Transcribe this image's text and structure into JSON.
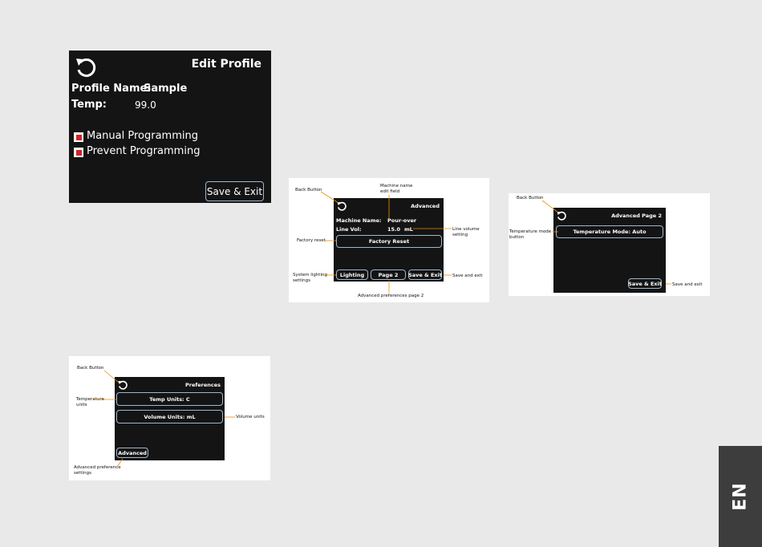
{
  "edit_profile": {
    "title": "Edit Profile",
    "profile_name_label": "Profile Name:",
    "profile_name_value": "Sample",
    "temp_label": "Temp:",
    "temp_value": "99.0",
    "manual_programming": "Manual Programming",
    "prevent_programming": "Prevent Programming",
    "save_exit": "Save & Exit"
  },
  "advanced": {
    "title": "Advanced",
    "machine_name_label": "Machine Name:",
    "machine_name_value": "Pour-over",
    "line_vol_label": "Line Vol:",
    "line_vol_value": "15.0",
    "line_vol_unit": "mL",
    "factory_reset": "Factory Reset",
    "lighting": "Lighting",
    "page2": "Page 2",
    "save_exit": "Save & Exit",
    "callouts": {
      "back_button": "Back Button",
      "machine_name": "Machine name\nedit field",
      "line_volume": "Line volume\nsetting",
      "factory_reset": "Factory reset",
      "system_lighting": "System lighting\nsettings",
      "save_exit": "Save and exit",
      "page2": "Advanced preferences page 2"
    }
  },
  "advanced_page2": {
    "title": "Advanced Page 2",
    "temperature_mode": "Temperature Mode: Auto",
    "save_exit": "Save & Exit",
    "callouts": {
      "back_button": "Back Button",
      "temperature_mode": "Temperature mode\nbutton",
      "save_exit": "Save and exit"
    }
  },
  "preferences": {
    "title": "Preferences",
    "temp_units": "Temp Units: C",
    "volume_units": "Volume Units: mL",
    "advanced": "Advanced",
    "callouts": {
      "back_button": "Back Button",
      "temperature_units": "Temperature\nunits",
      "volume_units": "Volume units",
      "advanced_settings": "Advanced preference\nsettings"
    }
  },
  "language_tab": "EN",
  "colors": {
    "page_bg": "#e9e9e9",
    "screen_bg": "#141414",
    "button_border": "#9fb6cf",
    "checkbox": "#d0232a",
    "callout_line": "#f08c00",
    "tab_bg": "#3d3d3d"
  },
  "icons": [
    "refresh-back-icon"
  ]
}
